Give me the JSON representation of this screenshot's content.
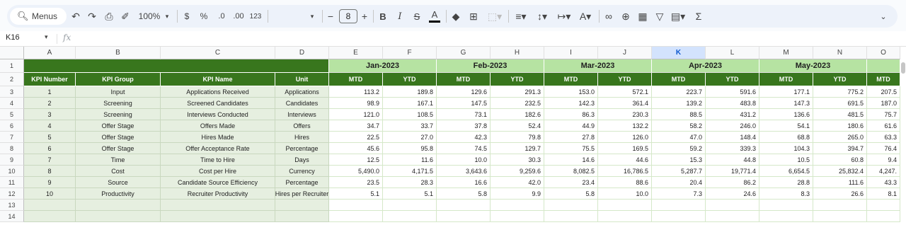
{
  "toolbar": {
    "menus_label": "Menus",
    "zoom": "100%",
    "currency": "$",
    "percent": "%",
    "decrease_decimal": ".0",
    "increase_decimal": ".00",
    "number_format": "123",
    "font_size": "8",
    "sum_symbol": "Σ"
  },
  "formula_bar": {
    "name_box": "K16",
    "fx": "fx"
  },
  "columns": [
    "A",
    "B",
    "C",
    "D",
    "E",
    "F",
    "G",
    "H",
    "I",
    "J",
    "K",
    "L",
    "M",
    "N",
    "O"
  ],
  "selected_column": "K",
  "rows": [
    "1",
    "2",
    "3",
    "4",
    "5",
    "6",
    "7",
    "8",
    "9",
    "10",
    "11",
    "12",
    "13",
    "14"
  ],
  "headers": {
    "kpi_number": "KPI Number",
    "kpi_group": "KPI Group",
    "kpi_name": "KPI Name",
    "unit": "Unit",
    "months": [
      "Jan-2023",
      "Feb-2023",
      "Mar-2023",
      "Apr-2023",
      "May-2023"
    ],
    "mtd": "MTD",
    "ytd": "YTD"
  },
  "kpis": [
    {
      "num": "1",
      "group": "Input",
      "name": "Applications Received",
      "unit": "Applications",
      "vals": [
        "113.2",
        "189.8",
        "129.6",
        "291.3",
        "153.0",
        "572.1",
        "223.7",
        "591.6",
        "177.1",
        "775.2",
        "207.5"
      ]
    },
    {
      "num": "2",
      "group": "Screening",
      "name": "Screened Candidates",
      "unit": "Candidates",
      "vals": [
        "98.9",
        "167.1",
        "147.5",
        "232.5",
        "142.3",
        "361.4",
        "139.2",
        "483.8",
        "147.3",
        "691.5",
        "187.0"
      ]
    },
    {
      "num": "3",
      "group": "Screening",
      "name": "Interviews Conducted",
      "unit": "Interviews",
      "vals": [
        "121.0",
        "108.5",
        "73.1",
        "182.6",
        "86.3",
        "230.3",
        "88.5",
        "431.2",
        "136.6",
        "481.5",
        "75.7"
      ]
    },
    {
      "num": "4",
      "group": "Offer Stage",
      "name": "Offers Made",
      "unit": "Offers",
      "vals": [
        "34.7",
        "33.7",
        "37.8",
        "52.4",
        "44.9",
        "132.2",
        "58.2",
        "246.0",
        "54.1",
        "180.6",
        "61.6"
      ]
    },
    {
      "num": "5",
      "group": "Offer Stage",
      "name": "Hires Made",
      "unit": "Hires",
      "vals": [
        "22.5",
        "27.0",
        "42.3",
        "79.8",
        "27.8",
        "126.0",
        "47.0",
        "148.4",
        "68.8",
        "265.0",
        "63.3"
      ]
    },
    {
      "num": "6",
      "group": "Offer Stage",
      "name": "Offer Acceptance Rate",
      "unit": "Percentage",
      "vals": [
        "45.6",
        "95.8",
        "74.5",
        "129.7",
        "75.5",
        "169.5",
        "59.2",
        "339.3",
        "104.3",
        "394.7",
        "76.4"
      ]
    },
    {
      "num": "7",
      "group": "Time",
      "name": "Time to Hire",
      "unit": "Days",
      "vals": [
        "12.5",
        "11.6",
        "10.0",
        "30.3",
        "14.6",
        "44.6",
        "15.3",
        "44.8",
        "10.5",
        "60.8",
        "9.4"
      ]
    },
    {
      "num": "8",
      "group": "Cost",
      "name": "Cost per Hire",
      "unit": "Currency",
      "vals": [
        "5,490.0",
        "4,171.5",
        "3,643.6",
        "9,259.6",
        "8,082.5",
        "16,786.5",
        "5,287.7",
        "19,771.4",
        "6,654.5",
        "25,832.4",
        "4,247."
      ]
    },
    {
      "num": "9",
      "group": "Source",
      "name": "Candidate Source Efficiency",
      "unit": "Percentage",
      "vals": [
        "23.5",
        "28.3",
        "16.6",
        "42.0",
        "23.4",
        "88.6",
        "20.4",
        "86.2",
        "28.8",
        "111.6",
        "43.3"
      ]
    },
    {
      "num": "10",
      "group": "Productivity",
      "name": "Recruiter Productivity",
      "unit": "Hires per Recruiter",
      "vals": [
        "5.1",
        "5.1",
        "5.8",
        "9.9",
        "5.8",
        "10.0",
        "7.3",
        "24.6",
        "8.3",
        "26.6",
        "8.1"
      ]
    }
  ]
}
